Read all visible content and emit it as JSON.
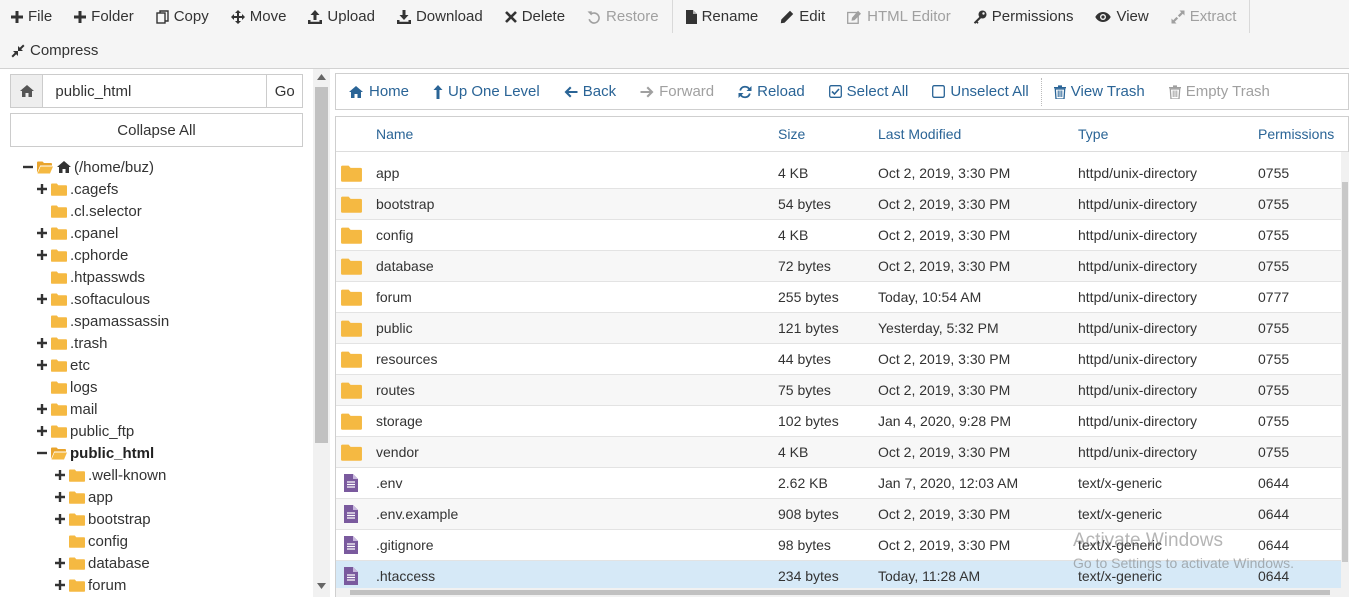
{
  "toolbar": {
    "row1": [
      {
        "id": "file",
        "label": "File",
        "icon": "plus-icon",
        "disabled": false
      },
      {
        "id": "folder",
        "label": "Folder",
        "icon": "plus-icon",
        "disabled": false
      },
      {
        "id": "copy",
        "label": "Copy",
        "icon": "copy-icon",
        "disabled": false
      },
      {
        "id": "move",
        "label": "Move",
        "icon": "move-arrows-icon",
        "disabled": false
      },
      {
        "id": "upload",
        "label": "Upload",
        "icon": "upload-icon",
        "disabled": false
      },
      {
        "id": "download",
        "label": "Download",
        "icon": "download-icon",
        "disabled": false
      },
      {
        "id": "delete",
        "label": "Delete",
        "icon": "x-icon",
        "disabled": false
      },
      {
        "id": "restore",
        "label": "Restore",
        "icon": "undo-icon",
        "disabled": true
      },
      {
        "id": "rename",
        "label": "Rename",
        "icon": "file-icon",
        "disabled": false
      },
      {
        "id": "edit",
        "label": "Edit",
        "icon": "pencil-icon",
        "disabled": false
      },
      {
        "id": "html-editor",
        "label": "HTML Editor",
        "icon": "pencil-square-icon",
        "disabled": true
      },
      {
        "id": "permissions",
        "label": "Permissions",
        "icon": "key-icon",
        "disabled": false
      },
      {
        "id": "view",
        "label": "View",
        "icon": "eye-icon",
        "disabled": false
      },
      {
        "id": "extract",
        "label": "Extract",
        "icon": "expand-icon",
        "disabled": true
      }
    ],
    "row2": [
      {
        "id": "compress",
        "label": "Compress",
        "icon": "compress-icon",
        "disabled": false
      }
    ]
  },
  "left_panel": {
    "path_value": "public_html",
    "go_label": "Go",
    "collapse_label": "Collapse All",
    "tree": [
      {
        "label": "(/home/buz)",
        "level": 0,
        "toggle": "minus",
        "open": true,
        "home": true
      },
      {
        "label": ".cagefs",
        "level": 1,
        "toggle": "plus",
        "open": false
      },
      {
        "label": ".cl.selector",
        "level": 1,
        "toggle": "none",
        "open": false
      },
      {
        "label": ".cpanel",
        "level": 1,
        "toggle": "plus",
        "open": false
      },
      {
        "label": ".cphorde",
        "level": 1,
        "toggle": "plus",
        "open": false
      },
      {
        "label": ".htpasswds",
        "level": 1,
        "toggle": "none",
        "open": false
      },
      {
        "label": ".softaculous",
        "level": 1,
        "toggle": "plus",
        "open": false
      },
      {
        "label": ".spamassassin",
        "level": 1,
        "toggle": "none",
        "open": false
      },
      {
        "label": ".trash",
        "level": 1,
        "toggle": "plus",
        "open": false
      },
      {
        "label": "etc",
        "level": 1,
        "toggle": "plus",
        "open": false
      },
      {
        "label": "logs",
        "level": 1,
        "toggle": "none",
        "open": false
      },
      {
        "label": "mail",
        "level": 1,
        "toggle": "plus",
        "open": false
      },
      {
        "label": "public_ftp",
        "level": 1,
        "toggle": "plus",
        "open": false
      },
      {
        "label": "public_html",
        "level": 1,
        "toggle": "minus",
        "open": true,
        "bold": true
      },
      {
        "label": ".well-known",
        "level": 2,
        "toggle": "plus",
        "open": false
      },
      {
        "label": "app",
        "level": 2,
        "toggle": "plus",
        "open": false
      },
      {
        "label": "bootstrap",
        "level": 2,
        "toggle": "plus",
        "open": false
      },
      {
        "label": "config",
        "level": 2,
        "toggle": "none",
        "open": false
      },
      {
        "label": "database",
        "level": 2,
        "toggle": "plus",
        "open": false
      },
      {
        "label": "forum",
        "level": 2,
        "toggle": "plus",
        "open": false
      }
    ]
  },
  "navbar": [
    {
      "id": "home",
      "label": "Home",
      "icon": "home-icon",
      "disabled": false
    },
    {
      "id": "up-one-level",
      "label": "Up One Level",
      "icon": "arrow-up-icon",
      "disabled": false
    },
    {
      "id": "back",
      "label": "Back",
      "icon": "arrow-left-icon",
      "disabled": false
    },
    {
      "id": "forward",
      "label": "Forward",
      "icon": "arrow-right-icon",
      "disabled": true
    },
    {
      "id": "reload",
      "label": "Reload",
      "icon": "refresh-icon",
      "disabled": false
    },
    {
      "id": "select-all",
      "label": "Select All",
      "icon": "checked-box-icon",
      "disabled": false
    },
    {
      "id": "unselect-all",
      "label": "Unselect All",
      "icon": "empty-box-icon",
      "disabled": false
    },
    {
      "id": "view-trash",
      "label": "View Trash",
      "icon": "trash-icon",
      "disabled": false
    },
    {
      "id": "empty-trash",
      "label": "Empty Trash",
      "icon": "trash-icon",
      "disabled": true
    }
  ],
  "table": {
    "columns": [
      "Name",
      "Size",
      "Last Modified",
      "Type",
      "Permissions"
    ],
    "rows": [
      {
        "kind": "folder",
        "name": "app",
        "size": "4 KB",
        "modified": "Oct 2, 2019, 3:30 PM",
        "type": "httpd/unix-directory",
        "perms": "0755"
      },
      {
        "kind": "folder",
        "name": "bootstrap",
        "size": "54 bytes",
        "modified": "Oct 2, 2019, 3:30 PM",
        "type": "httpd/unix-directory",
        "perms": "0755"
      },
      {
        "kind": "folder",
        "name": "config",
        "size": "4 KB",
        "modified": "Oct 2, 2019, 3:30 PM",
        "type": "httpd/unix-directory",
        "perms": "0755"
      },
      {
        "kind": "folder",
        "name": "database",
        "size": "72 bytes",
        "modified": "Oct 2, 2019, 3:30 PM",
        "type": "httpd/unix-directory",
        "perms": "0755"
      },
      {
        "kind": "folder",
        "name": "forum",
        "size": "255 bytes",
        "modified": "Today, 10:54 AM",
        "type": "httpd/unix-directory",
        "perms": "0777"
      },
      {
        "kind": "folder",
        "name": "public",
        "size": "121 bytes",
        "modified": "Yesterday, 5:32 PM",
        "type": "httpd/unix-directory",
        "perms": "0755"
      },
      {
        "kind": "folder",
        "name": "resources",
        "size": "44 bytes",
        "modified": "Oct 2, 2019, 3:30 PM",
        "type": "httpd/unix-directory",
        "perms": "0755"
      },
      {
        "kind": "folder",
        "name": "routes",
        "size": "75 bytes",
        "modified": "Oct 2, 2019, 3:30 PM",
        "type": "httpd/unix-directory",
        "perms": "0755"
      },
      {
        "kind": "folder",
        "name": "storage",
        "size": "102 bytes",
        "modified": "Jan 4, 2020, 9:28 PM",
        "type": "httpd/unix-directory",
        "perms": "0755"
      },
      {
        "kind": "folder",
        "name": "vendor",
        "size": "4 KB",
        "modified": "Oct 2, 2019, 3:30 PM",
        "type": "httpd/unix-directory",
        "perms": "0755"
      },
      {
        "kind": "file",
        "name": ".env",
        "size": "2.62 KB",
        "modified": "Jan 7, 2020, 12:03 AM",
        "type": "text/x-generic",
        "perms": "0644"
      },
      {
        "kind": "file",
        "name": ".env.example",
        "size": "908 bytes",
        "modified": "Oct 2, 2019, 3:30 PM",
        "type": "text/x-generic",
        "perms": "0644"
      },
      {
        "kind": "file",
        "name": ".gitignore",
        "size": "98 bytes",
        "modified": "Oct 2, 2019, 3:30 PM",
        "type": "text/x-generic",
        "perms": "0644"
      },
      {
        "kind": "file",
        "name": ".htaccess",
        "size": "234 bytes",
        "modified": "Today, 11:28 AM",
        "type": "text/x-generic",
        "perms": "0644",
        "selected": true
      }
    ]
  },
  "watermark": {
    "title": "Activate Windows",
    "subtitle": "Go to Settings to activate Windows."
  },
  "colors": {
    "link": "#2a6496",
    "folder": "#f5b942",
    "file": "#7a5a9e",
    "selected_row": "#d6e9f7",
    "disabled": "#a0a0a0"
  }
}
